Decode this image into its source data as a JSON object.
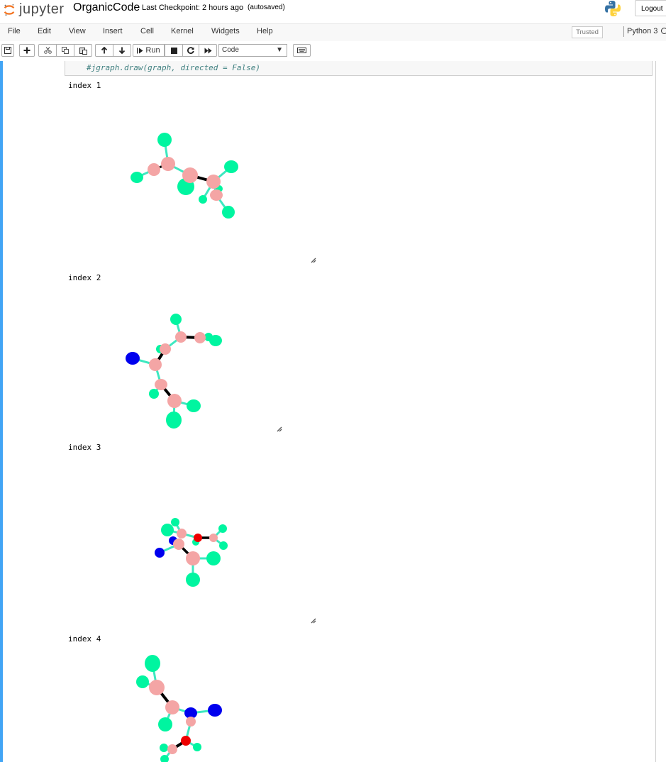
{
  "header": {
    "logo_text": "jupyter",
    "notebook_name": "OrganicCode",
    "checkpoint": "Last Checkpoint: 2 hours ago",
    "autosave": "(autosaved)",
    "logout_label": "Logout"
  },
  "menubar": {
    "items": [
      "File",
      "Edit",
      "View",
      "Insert",
      "Cell",
      "Kernel",
      "Widgets",
      "Help"
    ],
    "trusted_label": "Trusted",
    "kernel_label": "Python 3"
  },
  "toolbar": {
    "run_label": "Run",
    "cell_type": "Code"
  },
  "cells": {
    "code_line": "#jgraph.draw(graph, directed = False)",
    "outputs": [
      {
        "label": "index 1"
      },
      {
        "label": "index 2"
      },
      {
        "label": "index 3"
      },
      {
        "label": "index 4"
      }
    ]
  },
  "colors": {
    "accent": "#42a5f5",
    "hydrogen": "#00f5a0",
    "carbon": "#f4a5a5",
    "nitrogen": "#0000ee",
    "oxygen": "#ee0000",
    "bond": "#3de8c0",
    "double_bond": "#000000"
  }
}
